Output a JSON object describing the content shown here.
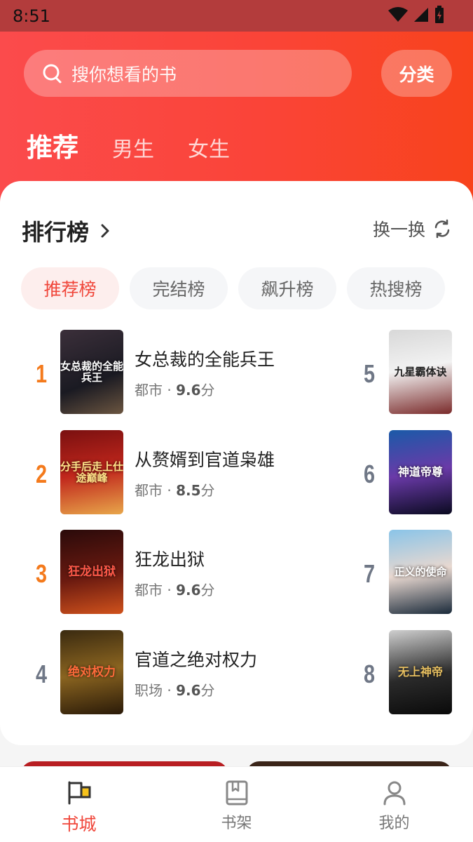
{
  "status_bar": {
    "time": "8:51"
  },
  "search": {
    "placeholder": "搜你想看的书"
  },
  "category_button": "分类",
  "top_tabs": [
    {
      "label": "推荐",
      "active": true
    },
    {
      "label": "男生",
      "active": false
    },
    {
      "label": "女生",
      "active": false
    }
  ],
  "ranking": {
    "title": "排行榜",
    "refresh_label": "换一换",
    "chips": [
      {
        "label": "推荐榜",
        "active": true
      },
      {
        "label": "完结榜",
        "active": false
      },
      {
        "label": "飙升榜",
        "active": false
      },
      {
        "label": "热搜榜",
        "active": false
      }
    ],
    "books": [
      {
        "rank": "1",
        "title": "女总裁的全能兵王",
        "genre": "都市",
        "sep": " · ",
        "score": "9.6",
        "unit": "分",
        "cover_text": "女总裁的全能兵王"
      },
      {
        "rank": "2",
        "title": "从赘婿到官道枭雄",
        "genre": "都市",
        "sep": " · ",
        "score": "8.5",
        "unit": "分",
        "cover_text": "分手后走上仕途巅峰"
      },
      {
        "rank": "3",
        "title": "狂龙出狱",
        "genre": "都市",
        "sep": " · ",
        "score": "9.6",
        "unit": "分",
        "cover_text": "狂龙出狱"
      },
      {
        "rank": "4",
        "title": "官道之绝对权力",
        "genre": "职场",
        "sep": " · ",
        "score": "9.6",
        "unit": "分",
        "cover_text": "绝对权力"
      },
      {
        "rank": "5",
        "cover_text": "九星霸体诀"
      },
      {
        "rank": "6",
        "cover_text": "神道帝尊"
      },
      {
        "rank": "7",
        "cover_text": "正义的使命"
      },
      {
        "rank": "8",
        "cover_text": "无上神帝"
      }
    ]
  },
  "bottom_nav": [
    {
      "label": "书城",
      "icon": "flag-icon",
      "active": true
    },
    {
      "label": "书架",
      "icon": "book-icon",
      "active": false
    },
    {
      "label": "我的",
      "icon": "person-icon",
      "active": false
    }
  ],
  "colors": {
    "accent": "#f0463a",
    "header": "#fa4438",
    "rank_hot": "#f47a1c",
    "rank_cold": "#6f7786"
  }
}
